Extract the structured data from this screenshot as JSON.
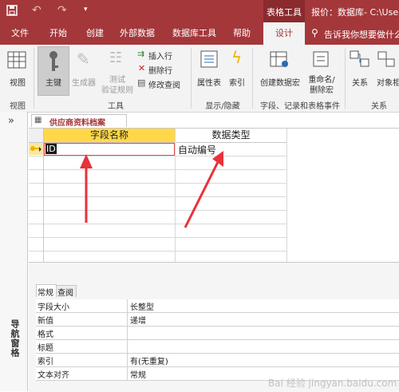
{
  "titlebar": {
    "context_label": "表格工具",
    "title": "报价：数据库- C:\\User"
  },
  "tabs": [
    "文件",
    "开始",
    "创建",
    "外部数据",
    "数据库工具",
    "帮助",
    "设计"
  ],
  "search": {
    "placeholder": "告诉我你想要做什么"
  },
  "ribbon": {
    "view": {
      "label": "视图",
      "group": "视图"
    },
    "tools": {
      "primary_key": "主键",
      "builder": "生成器",
      "test_rules_1": "测试",
      "test_rules_2": "验证规则",
      "insert_row": "插入行",
      "delete_row": "删除行",
      "modify_lookup": "修改查阅",
      "group": "工具"
    },
    "show_hide": {
      "property_sheet": "属性表",
      "indexes": "索引",
      "group": "显示/隐藏"
    },
    "events": {
      "create_macro": "创建数据宏",
      "rename_1": "重命名/",
      "rename_2": "删除宏",
      "group": "字段、记录和表格事件"
    },
    "relationships": {
      "relations": "关系",
      "object_deps": "对象相",
      "group": "关系"
    }
  },
  "nav": {
    "collapse": "»",
    "label": "导航窗格"
  },
  "document": {
    "tab_title": "供应商资料档案",
    "columns": [
      "字段名称",
      "数据类型"
    ],
    "rows": [
      {
        "field": "ID",
        "type": "自动编号"
      }
    ]
  },
  "properties": {
    "tabs": [
      "常规",
      "查阅"
    ],
    "rows": [
      {
        "name": "字段大小",
        "value": "长整型"
      },
      {
        "name": "新值",
        "value": "递增"
      },
      {
        "name": "格式",
        "value": ""
      },
      {
        "name": "标题",
        "value": ""
      },
      {
        "name": "索引",
        "value": "有(无重复)"
      },
      {
        "name": "文本对齐",
        "value": "常规"
      }
    ]
  },
  "watermark": "Bai 经验 jingyan.baidu.com",
  "colors": {
    "accent": "#a4373a",
    "arrow": "#e8323c",
    "key": "#f2b200"
  }
}
